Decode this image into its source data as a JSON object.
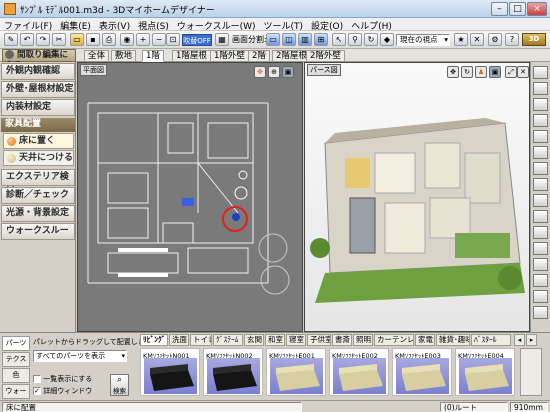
{
  "window": {
    "title": "ｻﾝﾌﾟﾙ ﾓﾃﾞﾙ001.m3d - 3Dマイホームデザイナー",
    "min": "–",
    "max": "□",
    "close": "×"
  },
  "menu": [
    "ファイル(F)",
    "編集(E)",
    "表示(V)",
    "視点(S)",
    "ウォークスルー(W)",
    "ツール(T)",
    "設定(O)",
    "ヘルプ(H)"
  ],
  "toolbar": {
    "mode_toggle": "吹替OFF",
    "screen_split_label": "画面分割:",
    "viewpoint_select": "現在の視点"
  },
  "back_button": "間取り編集に戻る",
  "floor_tabs": [
    "全体",
    "敷地",
    "1階",
    "1階屋根",
    "1階外壁",
    "2階",
    "2階屋根",
    "2階外壁"
  ],
  "floor_active": 2,
  "left_menu": {
    "items": [
      "外観内観確認",
      "外壁･屋根材設定",
      "内装材設定"
    ],
    "section": "家具配置",
    "sub_items": [
      "床に置く",
      "天井につける"
    ],
    "items2": [
      "エクステリア検討",
      "診断／チェック",
      "光源・背景設定",
      "ウォークスルー"
    ]
  },
  "views": {
    "plan_label": "平面図",
    "render_label": "パース図"
  },
  "parts": {
    "side_tabs": [
      "パーツ",
      "テクスチャ",
      "色",
      "ウォーク"
    ],
    "hint": "パレットからドラッグして配置します。",
    "filter_select": "すべてのパーツを表示",
    "check_list_view": "一覧表示にする",
    "check_detail_window": "詳細ウィンドウ",
    "search_button": "検索",
    "category_tabs": [
      "ﾘﾋﾞﾝｸﾞ",
      "洗面",
      "トイレ",
      "ｸﾞｽﾃｰﾑ",
      "玄関",
      "和室",
      "寝室",
      "子供室",
      "書斎",
      "照明",
      "カーテンレーラ",
      "家電",
      "雑貨･趣味",
      "ﾊﾞｽﾀｰﾙ"
    ],
    "category_active": 0,
    "thumbnails": [
      {
        "label": "KMｿﾌｧｾｯﾄN001",
        "kind": "dark"
      },
      {
        "label": "KMｿﾌｧｾｯﾄN002",
        "kind": "dark"
      },
      {
        "label": "KMｿﾌｧｾｯﾄE001",
        "kind": "light"
      },
      {
        "label": "KMｿﾌｧｾｯﾄE002",
        "kind": "light"
      },
      {
        "label": "KMｿﾌｧｾｯﾄE003",
        "kind": "light"
      },
      {
        "label": "KMｿﾌｧｾｯﾄE004",
        "kind": "light"
      }
    ]
  },
  "status": {
    "left": "床に配置",
    "mid": "(0)ルート",
    "right": "910mm"
  },
  "colors": {
    "accent": "#e0691a",
    "marker": "#e02020",
    "back_button": "#b6a684"
  }
}
